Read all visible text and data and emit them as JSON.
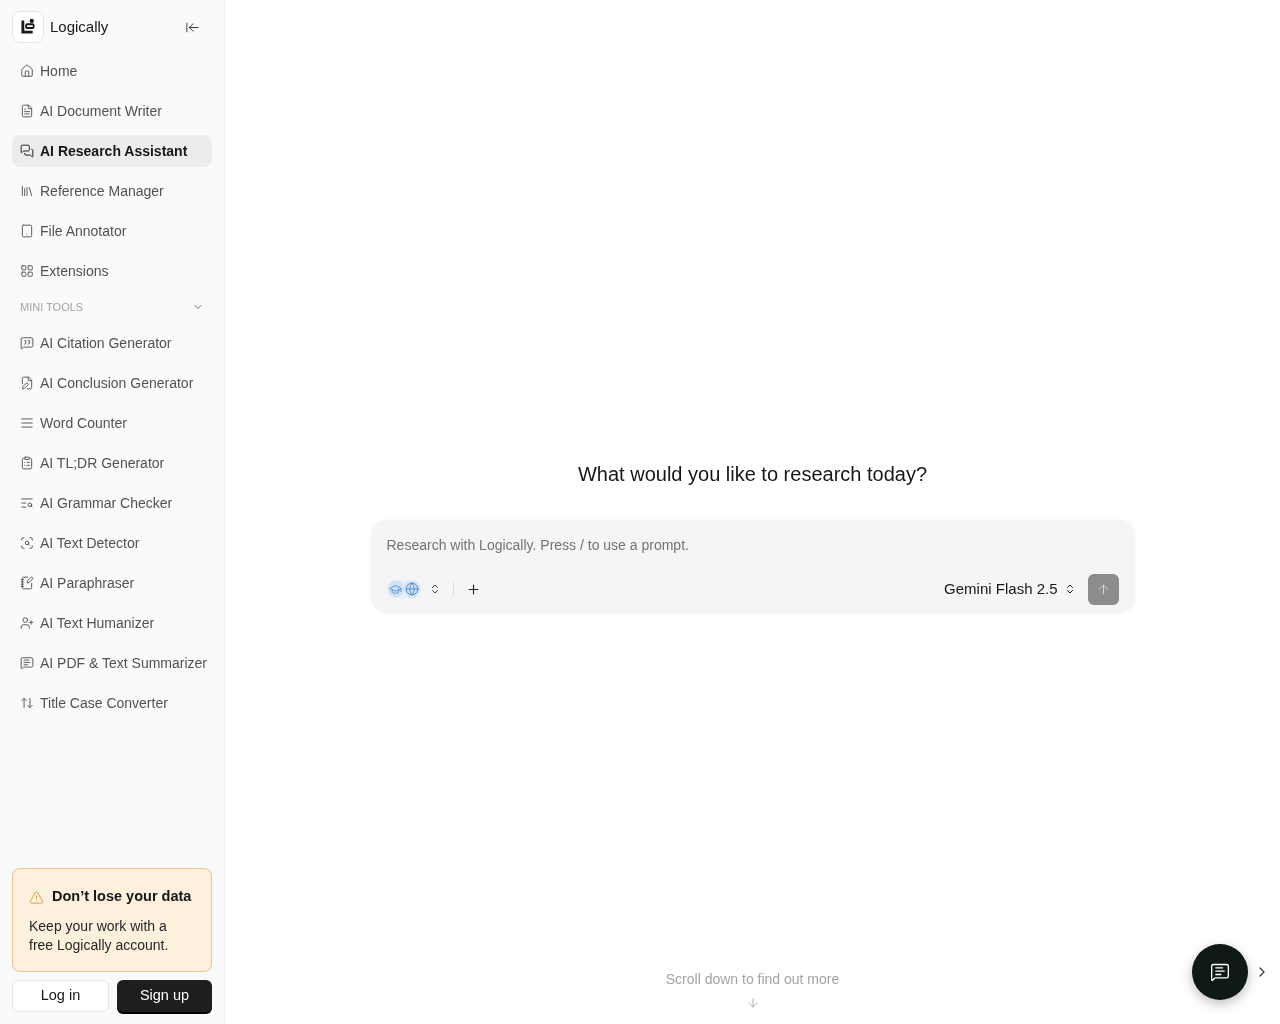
{
  "sidebar": {
    "brand": "Logically",
    "nav": [
      {
        "label": "Home",
        "selected": false
      },
      {
        "label": "AI Document Writer",
        "selected": false
      },
      {
        "label": "AI Research Assistant",
        "selected": true
      },
      {
        "label": "Reference Manager",
        "selected": false
      },
      {
        "label": "File Annotator",
        "selected": false
      },
      {
        "label": "Extensions",
        "selected": false
      }
    ],
    "section": {
      "title": "MINI TOOLS",
      "expanded": true
    },
    "tools": [
      {
        "label": "AI Citation Generator",
        "selected": false
      },
      {
        "label": "AI Conclusion Generator",
        "selected": false
      },
      {
        "label": "Word Counter",
        "selected": false
      },
      {
        "label": "AI TL;DR Generator",
        "selected": false
      },
      {
        "label": "AI Grammar Checker",
        "selected": false
      },
      {
        "label": "AI Text Detector",
        "selected": false
      },
      {
        "label": "AI Paraphraser",
        "selected": false
      },
      {
        "label": "AI Text Humanizer",
        "selected": false
      },
      {
        "label": "AI PDF & Text Summarizer",
        "selected": false
      },
      {
        "label": "Title Case Converter",
        "selected": false
      }
    ],
    "notice": {
      "title": "Don’t lose your data",
      "body": "Keep your work with a free Logically account."
    },
    "buttons": [
      {
        "label": "Log in",
        "kind": "outline"
      },
      {
        "label": "Sign up",
        "kind": "solid"
      }
    ]
  },
  "main": {
    "heading": "What would you like to research today?",
    "prompt": {
      "placeholder": "Research with Logically. Press / to use a prompt.",
      "modes": [
        {
          "selected": true
        },
        {
          "selected": true
        }
      ],
      "model": "Gemini Flash 2.5",
      "send_disabled": true
    },
    "scroll_hint": "Scroll down to find out more"
  }
}
